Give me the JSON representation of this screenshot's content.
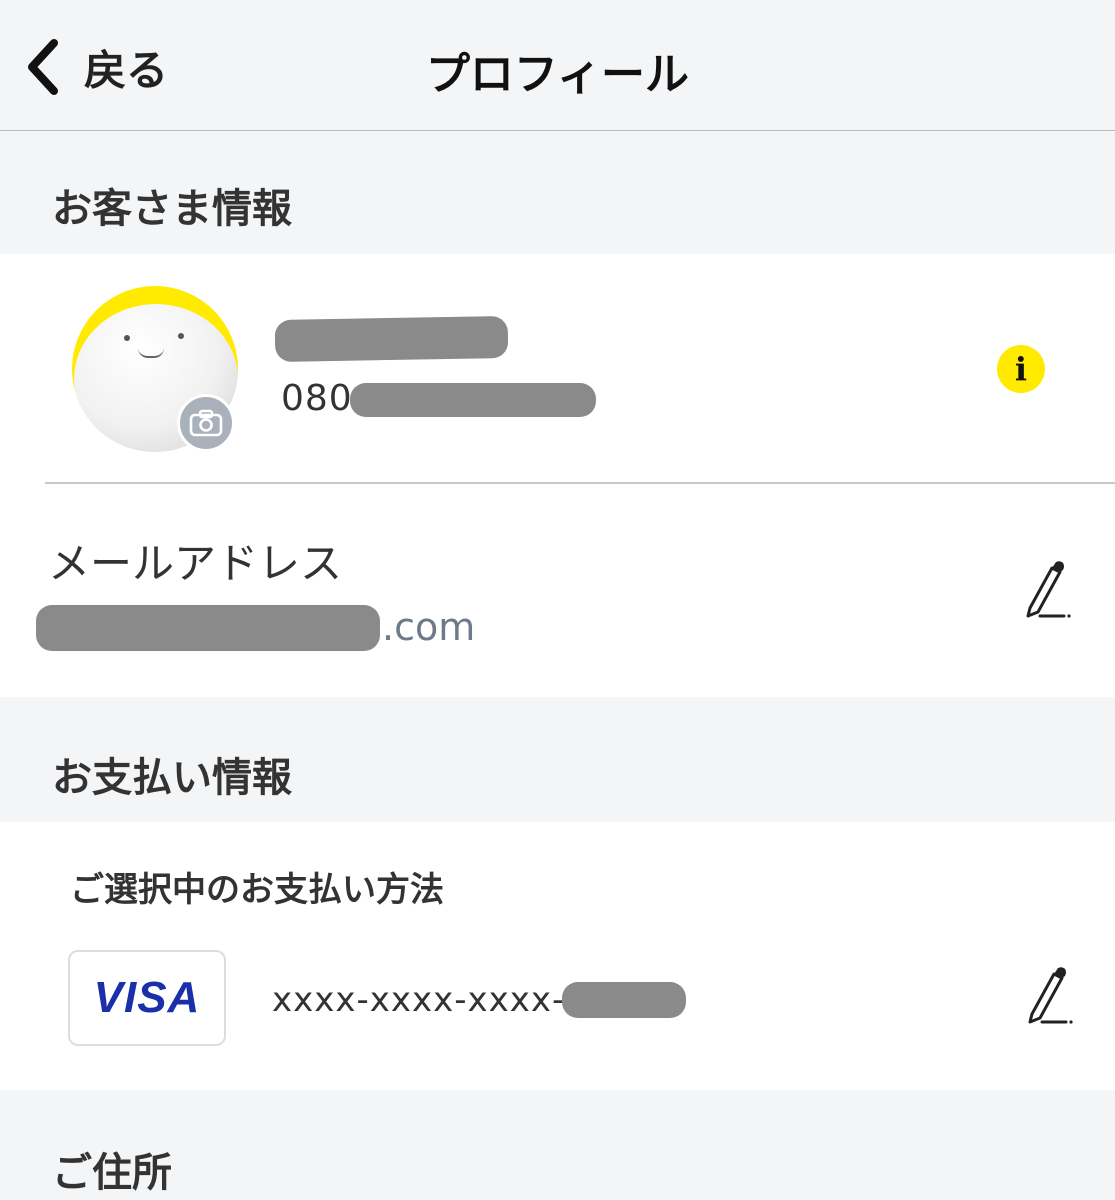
{
  "nav": {
    "back_label": "戻る",
    "title": "プロフィール"
  },
  "customer": {
    "section_title": "お客さま情報",
    "phone_prefix": "080",
    "email_label": "メールアドレス",
    "email_suffix": ".com"
  },
  "payment": {
    "section_title": "お支払い情報",
    "subtitle": "ご選択中のお支払い方法",
    "card_brand": "VISA",
    "card_number_prefix": "xxxx-xxxx-xxxx-"
  },
  "address": {
    "section_title": "ご住所"
  },
  "colors": {
    "accent_yellow": "#ffea00",
    "background": "#f4f5f7",
    "visa_blue": "#1a2fa8"
  }
}
